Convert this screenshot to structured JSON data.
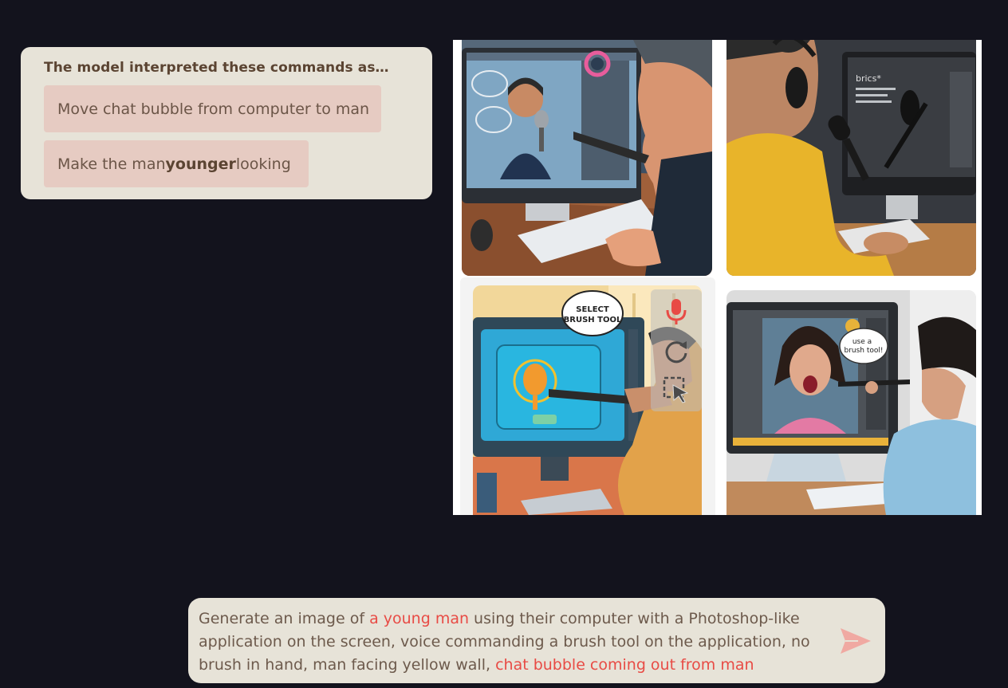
{
  "interpretation": {
    "title": "The model interpreted these commands as…",
    "commands": [
      {
        "text": "Move chat bubble from computer to man"
      },
      {
        "pre": "Make the man ",
        "bold": "younger",
        "post": " looking"
      }
    ]
  },
  "images": {
    "tile_3_bubble": [
      "SELECT",
      "BRUSH TOOL"
    ],
    "tile_4_bubble": [
      "use a",
      "brush tool!"
    ],
    "tile_2_screen_text": "brics*"
  },
  "overlay_tools": [
    {
      "icon": "microphone-icon",
      "color": "#e84b45"
    },
    {
      "icon": "regenerate-icon",
      "color": "#4a4a4a"
    },
    {
      "icon": "select-region-icon",
      "color": "#4a4a4a"
    }
  ],
  "prompt": {
    "segments": [
      {
        "text": "Generate an image of ",
        "highlight": false
      },
      {
        "text": "a young man",
        "highlight": true
      },
      {
        "text": " using their computer with a Photoshop-like application on  the screen, voice  commanding a brush tool on the application, no brush in hand, man facing yellow wall, ",
        "highlight": false
      },
      {
        "text": "chat bubble coming out from man",
        "highlight": true
      }
    ],
    "send_icon": "send-icon"
  },
  "colors": {
    "background": "#13131d",
    "panel": "#e7e3d8",
    "command_chip": "#e6cbc2",
    "highlight": "#e84b45",
    "send": "#f0a9a2"
  }
}
